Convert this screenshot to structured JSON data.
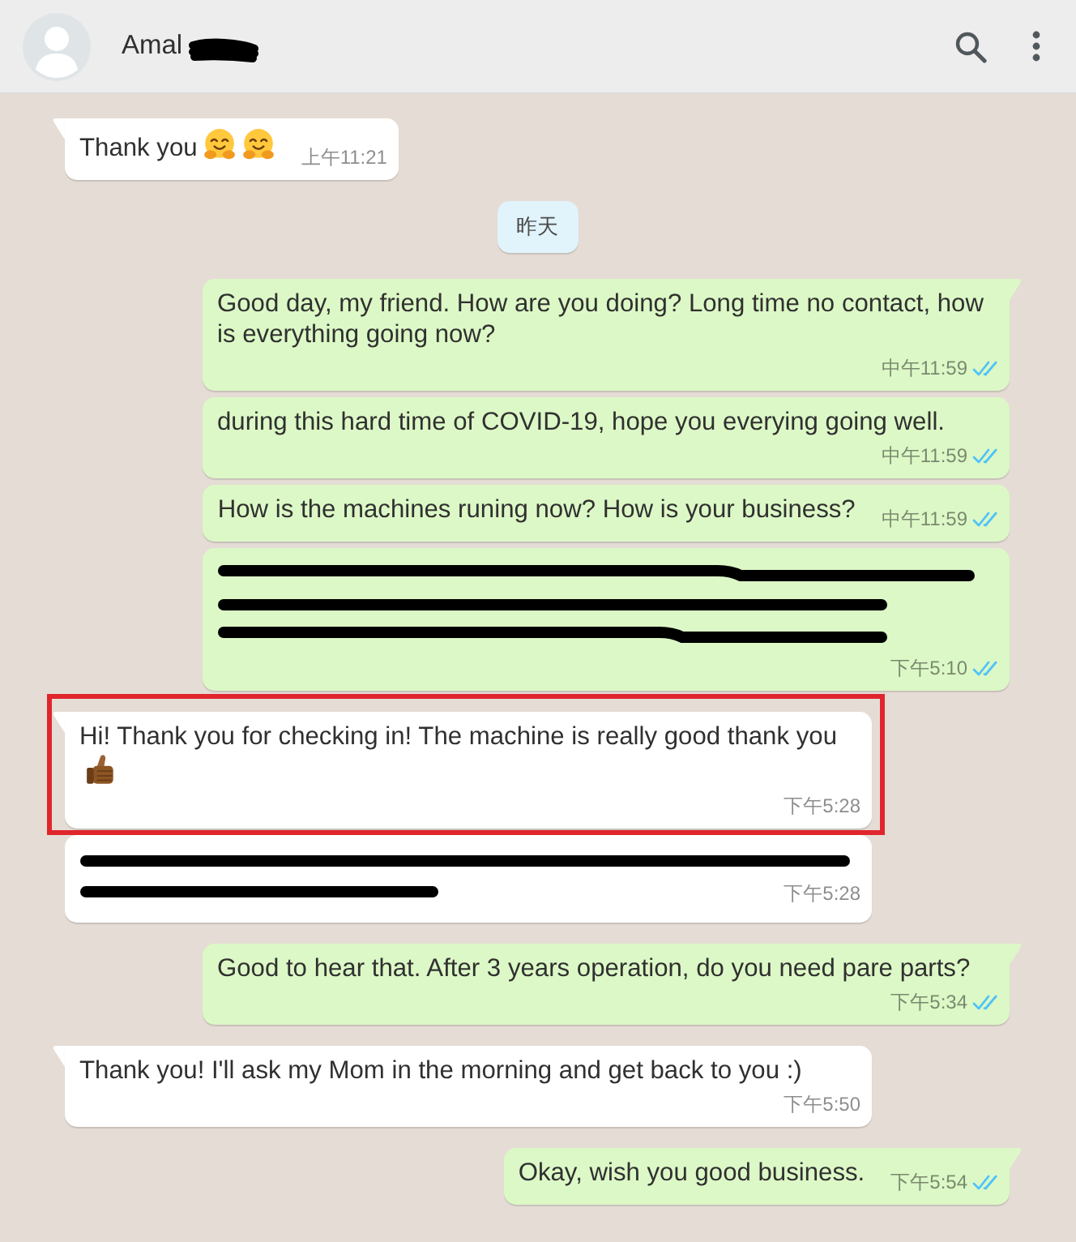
{
  "header": {
    "contact_name": "Amal",
    "name_redacted": true
  },
  "messages": [
    {
      "kind": "incoming",
      "text": "Thank you",
      "emoji": [
        {
          "kind": "hugging-face"
        },
        {
          "kind": "hugging-face"
        }
      ],
      "time": "上午11:21",
      "highlighted": false
    },
    {
      "kind": "date",
      "label": "昨天"
    },
    {
      "kind": "outgoing",
      "text": "Good day, my friend. How are you doing? Long time no contact, how is everything going now?",
      "time": "中午11:59",
      "read": true,
      "highlighted": false
    },
    {
      "kind": "outgoing",
      "text": "during this hard time of COVID-19, hope you everying going well.",
      "time": "中午11:59",
      "read": true,
      "highlighted": false
    },
    {
      "kind": "outgoing",
      "text": "How is the machines runing now? How is your business?",
      "time": "中午11:59",
      "read": true,
      "highlighted": false
    },
    {
      "kind": "outgoing",
      "redaction_strokes": [
        {
          "kind": "full-bent"
        },
        {
          "kind": "long"
        },
        {
          "kind": "long-bent"
        }
      ],
      "time": "下午5:10",
      "read": true,
      "highlighted": false
    },
    {
      "kind": "incoming",
      "text": "Hi! Thank you for checking in! The machine is really good thank you",
      "emoji": [
        {
          "kind": "thumbs-up"
        }
      ],
      "time": "下午5:28",
      "highlighted": true
    },
    {
      "kind": "incoming",
      "redaction_strokes": [
        {
          "kind": "full"
        },
        {
          "kind": "short"
        }
      ],
      "time": "下午5:28",
      "highlighted": false
    },
    {
      "kind": "outgoing",
      "text": "Good to hear that. After 3 years operation, do you need pare parts?",
      "time": "下午5:34",
      "read": true,
      "highlighted": false
    },
    {
      "kind": "incoming",
      "text": "Thank you! I'll ask my Mom in the morning and get back to you :)",
      "time": "下午5:50",
      "highlighted": false
    },
    {
      "kind": "outgoing",
      "text": "Okay, wish you good business.",
      "time": "下午5:54",
      "read": true,
      "highlighted": false
    }
  ]
}
